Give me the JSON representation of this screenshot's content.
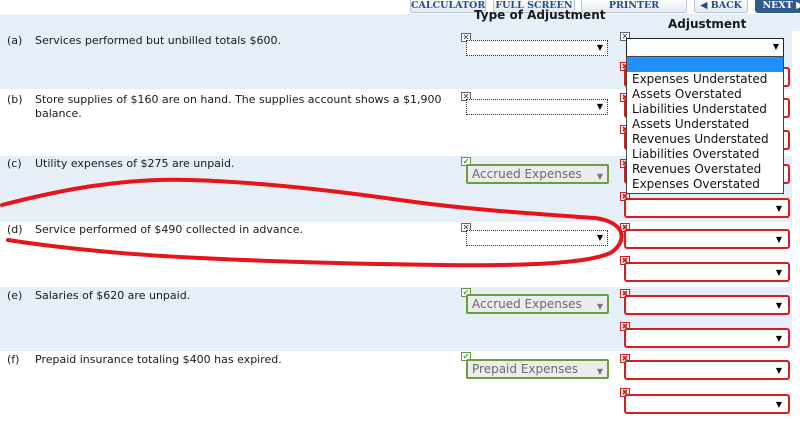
{
  "toolbar": {
    "calculator": "CALCULATOR",
    "full_screen": "FULL SCREEN",
    "printer_version": "PRINTER VERSION",
    "back": "◀ BACK",
    "next": "NEXT ▶"
  },
  "headers": {
    "type_of_adjustment": "Type of Adjustment",
    "adjustment": "Adjustment"
  },
  "rows": [
    {
      "letter": "(a)",
      "text": "Services performed but unbilled totals $600.",
      "type_value": ""
    },
    {
      "letter": "(b)",
      "text": "Store supplies of $160 are on hand. The supplies account shows a $1,900 balance.",
      "type_value": ""
    },
    {
      "letter": "(c)",
      "text": "Utility expenses of $275 are unpaid.",
      "type_value": "Accrued Expenses"
    },
    {
      "letter": "(d)",
      "text": "Service performed of $490 collected in advance.",
      "type_value": ""
    },
    {
      "letter": "(e)",
      "text": "Salaries of $620 are unpaid.",
      "type_value": "Accrued Expenses"
    },
    {
      "letter": "(f)",
      "text": "Prepaid insurance totaling $400 has expired.",
      "type_value": "Prepaid Expenses"
    }
  ],
  "dropdown": {
    "options": [
      "Expenses Understated",
      "Assets Overstated",
      "Liabilities Understated",
      "Assets Understated",
      "Revenues Understated",
      "Liabilities Overstated",
      "Revenues Overstated",
      "Expenses Overstated"
    ]
  },
  "icons": {
    "caret": "▼",
    "error_mark": "✖",
    "check_mark": "✔",
    "x_mark": "✕"
  },
  "colors": {
    "row_shade": "#e6eef7",
    "error_red": "#d91c1c",
    "ok_green": "#6b9e3e",
    "toolbar_next": "#2f5a8b",
    "highlight": "#1e90ff"
  }
}
